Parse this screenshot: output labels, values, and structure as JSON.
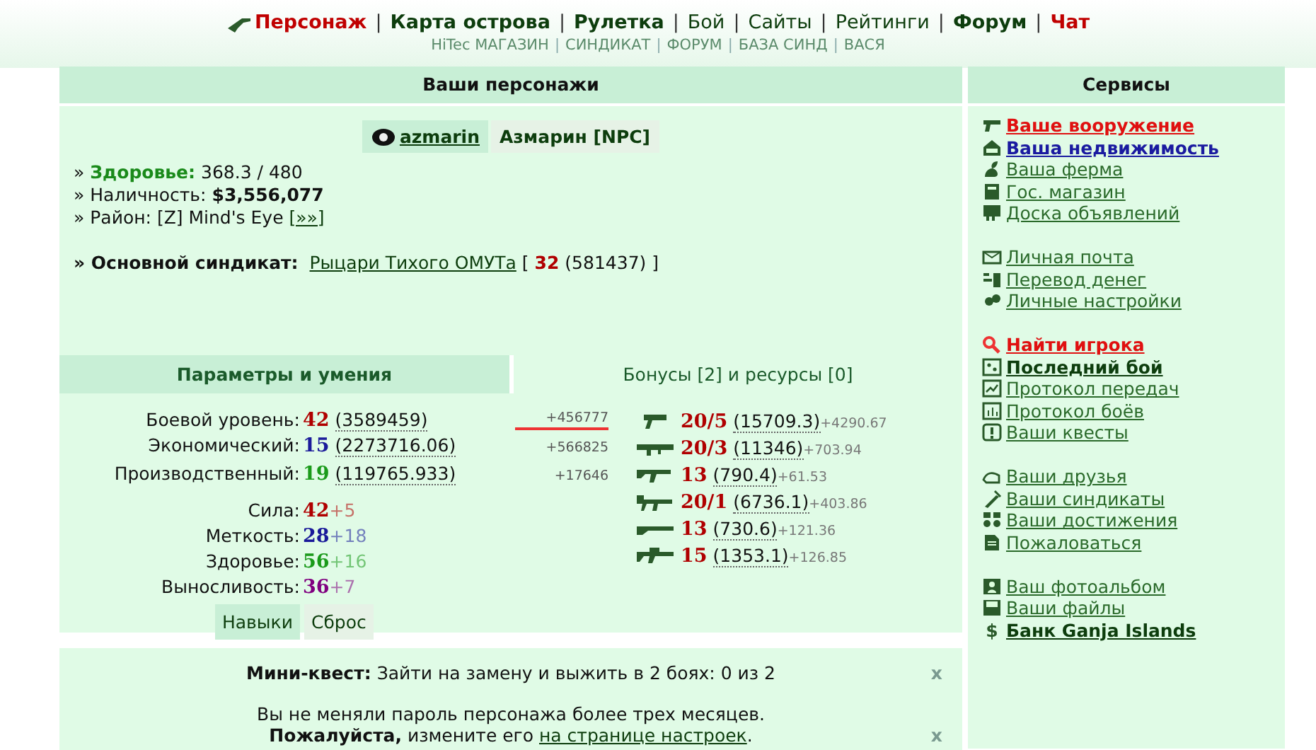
{
  "nav": [
    {
      "label": "Персонаж",
      "kind": "current"
    },
    {
      "label": "Карта острова",
      "kind": "bold"
    },
    {
      "label": "Рулетка",
      "kind": "bold"
    },
    {
      "label": "Бой",
      "kind": "plain"
    },
    {
      "label": "Сайты",
      "kind": "plain"
    },
    {
      "label": "Рейтинги",
      "kind": "plain"
    },
    {
      "label": "Форум",
      "kind": "bold"
    },
    {
      "label": "Чат",
      "kind": "current"
    }
  ],
  "nav_separator": "|",
  "subnav": [
    "HiTec МАГАЗИН",
    "СИНДИКАТ",
    "ФОРУМ",
    "БАЗА СИНД",
    "ВАСЯ"
  ],
  "subnav_separator": "|",
  "characters": {
    "title": "Ваши персонажи",
    "accounts": [
      {
        "label": "azmarin",
        "selected": true
      },
      {
        "label": "Азмарин [NPC]",
        "selected": false
      }
    ],
    "bullet": "»",
    "health": {
      "label": "Здоровье:",
      "value": "368.3 / 480"
    },
    "cash": {
      "label": "Наличность:",
      "value": "$3,556,077"
    },
    "district": {
      "label": "Район:",
      "value": "[Z] Mind's Eye",
      "link": "[»»]"
    },
    "syndicate": {
      "label": "Основной синдикат:",
      "name": "Рыцари Тихого ОМУТа",
      "open": "[",
      "level": "32",
      "points": "(581437)",
      "close": "]"
    }
  },
  "tabs": [
    {
      "label": "Параметры и умения",
      "selected": true
    },
    {
      "label": "Бонусы [2] и ресурсы [0]",
      "selected": false
    }
  ],
  "levels": [
    {
      "label": "Боевой уровень:",
      "value": "42",
      "color": "#b00000",
      "points": "(3589459)",
      "gain": "+456777",
      "marked": true
    },
    {
      "label": "Экономический:",
      "value": "15",
      "color": "#1a1a9a",
      "points": "(2273716.06)",
      "gain": "+566825",
      "marked": false
    },
    {
      "label": "Производственный:",
      "value": "19",
      "color": "#1a9a1a",
      "points": "(119765.933)",
      "gain": "+17646",
      "marked": false
    }
  ],
  "attributes": [
    {
      "label": "Сила:",
      "value": "42",
      "bonus": "+5",
      "color": "#b00000"
    },
    {
      "label": "Меткость:",
      "value": "28",
      "bonus": "+18",
      "color": "#1a1a9a"
    },
    {
      "label": "Здоровье:",
      "value": "56",
      "bonus": "+16",
      "color": "#1a9a1a"
    },
    {
      "label": "Выносливость:",
      "value": "36",
      "bonus": "+7",
      "color": "#800080"
    }
  ],
  "skill_buttons": [
    {
      "label": "Навыки",
      "selected": true
    },
    {
      "label": "Сброс",
      "selected": false
    }
  ],
  "weapons": [
    {
      "kind": "pistol",
      "value": "20/5",
      "points": "(15709.3)",
      "gain": "+4290.67"
    },
    {
      "kind": "launcher",
      "value": "20/3",
      "points": "(11346)",
      "gain": "+703.94"
    },
    {
      "kind": "rifle",
      "value": "13",
      "points": "(790.4)",
      "gain": "+61.53"
    },
    {
      "kind": "machinegun",
      "value": "20/1",
      "points": "(6736.1)",
      "gain": "+403.86"
    },
    {
      "kind": "shotgun",
      "value": "13",
      "points": "(730.6)",
      "gain": "+121.36"
    },
    {
      "kind": "sniper",
      "value": "15",
      "points": "(1353.1)",
      "gain": "+126.85"
    }
  ],
  "notices": [
    {
      "bold": "Мини-квест:",
      "text": "Зайти на замену и выжить в 2 боях: 0 из 2",
      "close": "x"
    },
    {
      "line": "Вы не меняли пароль персонажа более трех месяцев.",
      "bold": "Пожалуйста,",
      "text": "измените его",
      "link": "на странице настроек",
      "end": ".",
      "close": "x"
    }
  ],
  "services": {
    "title": "Сервисы",
    "groups": [
      [
        {
          "label": "Ваше вооружение",
          "kind": "red"
        },
        {
          "label": "Ваша недвижимость",
          "kind": "blue"
        },
        {
          "label": "Ваша ферма",
          "kind": "plain"
        },
        {
          "label": "Гос. магазин",
          "kind": "plain"
        },
        {
          "label": "Доска объявлений",
          "kind": "plain"
        }
      ],
      [
        {
          "label": "Личная почта",
          "kind": "plain"
        },
        {
          "label": "Перевод денег",
          "kind": "plain"
        },
        {
          "label": "Личные настройки",
          "kind": "plain"
        }
      ],
      [
        {
          "label": "Найти игрока",
          "kind": "red"
        },
        {
          "label": "Последний бой",
          "kind": "bold"
        },
        {
          "label": "Протокол передач",
          "kind": "plain"
        },
        {
          "label": "Протокол боёв",
          "kind": "plain"
        },
        {
          "label": "Ваши квесты",
          "kind": "plain"
        }
      ],
      [
        {
          "label": "Ваши друзья",
          "kind": "plain"
        },
        {
          "label": "Ваши синдикаты",
          "kind": "plain"
        },
        {
          "label": "Ваши достижения",
          "kind": "plain"
        },
        {
          "label": "Пожаловаться",
          "kind": "plain"
        }
      ],
      [
        {
          "label": "Ваш фотоальбом",
          "kind": "plain"
        },
        {
          "label": "Ваши файлы",
          "kind": "plain"
        },
        {
          "label": "Банк Ganja Islands",
          "kind": "bold",
          "glyph": "$"
        }
      ]
    ]
  }
}
